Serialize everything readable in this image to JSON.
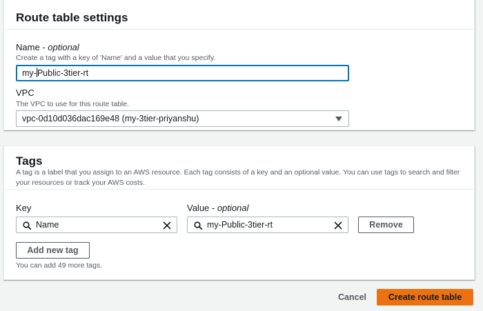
{
  "route_table_settings": {
    "title": "Route table settings",
    "name_label": "Name",
    "name_optional": "optional",
    "name_description": "Create a tag with a key of 'Name' and a value that you specify.",
    "name_value_before_caret": "my-",
    "name_value_after_caret": "Public-3tier-rt",
    "vpc_label": "VPC",
    "vpc_description": "The VPC to use for this route table.",
    "vpc_selected": "vpc-0d10d036dac169e48 (my-3tier-priyanshu)"
  },
  "tags": {
    "title": "Tags",
    "description": "A tag is a label that you assign to an AWS resource. Each tag consists of a key and an optional value. You can use tags to search and filter your resources or track your AWS costs.",
    "key_label": "Key",
    "value_label": "Value",
    "value_optional": "optional",
    "rows": [
      {
        "key": "Name",
        "value": "my-Public-3tier-rt"
      }
    ],
    "remove_label": "Remove",
    "add_new_tag_label": "Add new tag",
    "remaining_text": "You can add 49 more tags."
  },
  "footer": {
    "cancel_label": "Cancel",
    "create_label": "Create route table"
  },
  "colors": {
    "primary_button": "#ec7211",
    "focus_border": "#0073bb",
    "page_background": "#f2f3f3"
  },
  "icons": [
    "search-icon",
    "clear-icon",
    "caret-down-icon"
  ]
}
